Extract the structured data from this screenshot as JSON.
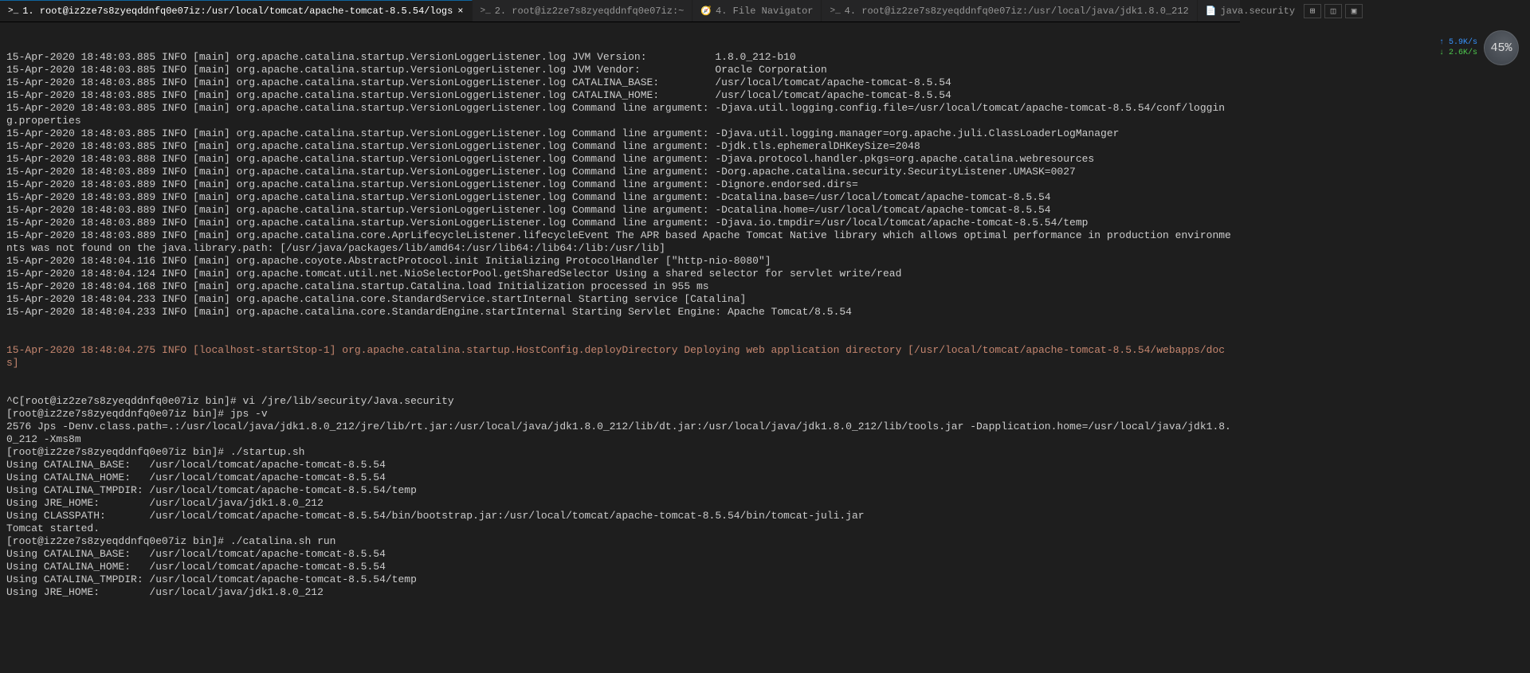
{
  "tabs": [
    {
      "icon": ">_",
      "label": "1. root@iz2ze7s8zyeqddnfq0e07iz:/usr/local/tomcat/apache-tomcat-8.5.54/logs",
      "active": true,
      "closeable": true
    },
    {
      "icon": ">_",
      "label": "2. root@iz2ze7s8zyeqddnfq0e07iz:~",
      "active": false
    },
    {
      "icon": "🧭",
      "label": "4. File Navigator",
      "active": false
    },
    {
      "icon": ">_",
      "label": "4. root@iz2ze7s8zyeqddnfq0e07iz:/usr/local/java/jdk1.8.0_212",
      "active": false
    },
    {
      "icon": "📄",
      "label": "java.security",
      "active": false
    }
  ],
  "lines": [
    "15-Apr-2020 18:48:03.885 INFO [main] org.apache.catalina.startup.VersionLoggerListener.log JVM Version:           1.8.0_212-b10",
    "15-Apr-2020 18:48:03.885 INFO [main] org.apache.catalina.startup.VersionLoggerListener.log JVM Vendor:            Oracle Corporation",
    "15-Apr-2020 18:48:03.885 INFO [main] org.apache.catalina.startup.VersionLoggerListener.log CATALINA_BASE:         /usr/local/tomcat/apache-tomcat-8.5.54",
    "15-Apr-2020 18:48:03.885 INFO [main] org.apache.catalina.startup.VersionLoggerListener.log CATALINA_HOME:         /usr/local/tomcat/apache-tomcat-8.5.54",
    "15-Apr-2020 18:48:03.885 INFO [main] org.apache.catalina.startup.VersionLoggerListener.log Command line argument: -Djava.util.logging.config.file=/usr/local/tomcat/apache-tomcat-8.5.54/conf/logging.properties",
    "15-Apr-2020 18:48:03.885 INFO [main] org.apache.catalina.startup.VersionLoggerListener.log Command line argument: -Djava.util.logging.manager=org.apache.juli.ClassLoaderLogManager",
    "15-Apr-2020 18:48:03.885 INFO [main] org.apache.catalina.startup.VersionLoggerListener.log Command line argument: -Djdk.tls.ephemeralDHKeySize=2048",
    "15-Apr-2020 18:48:03.888 INFO [main] org.apache.catalina.startup.VersionLoggerListener.log Command line argument: -Djava.protocol.handler.pkgs=org.apache.catalina.webresources",
    "15-Apr-2020 18:48:03.889 INFO [main] org.apache.catalina.startup.VersionLoggerListener.log Command line argument: -Dorg.apache.catalina.security.SecurityListener.UMASK=0027",
    "15-Apr-2020 18:48:03.889 INFO [main] org.apache.catalina.startup.VersionLoggerListener.log Command line argument: -Dignore.endorsed.dirs=",
    "15-Apr-2020 18:48:03.889 INFO [main] org.apache.catalina.startup.VersionLoggerListener.log Command line argument: -Dcatalina.base=/usr/local/tomcat/apache-tomcat-8.5.54",
    "15-Apr-2020 18:48:03.889 INFO [main] org.apache.catalina.startup.VersionLoggerListener.log Command line argument: -Dcatalina.home=/usr/local/tomcat/apache-tomcat-8.5.54",
    "15-Apr-2020 18:48:03.889 INFO [main] org.apache.catalina.startup.VersionLoggerListener.log Command line argument: -Djava.io.tmpdir=/usr/local/tomcat/apache-tomcat-8.5.54/temp",
    "15-Apr-2020 18:48:03.889 INFO [main] org.apache.catalina.core.AprLifecycleListener.lifecycleEvent The APR based Apache Tomcat Native library which allows optimal performance in production environments was not found on the java.library.path: [/usr/java/packages/lib/amd64:/usr/lib64:/lib64:/lib:/usr/lib]",
    "15-Apr-2020 18:48:04.116 INFO [main] org.apache.coyote.AbstractProtocol.init Initializing ProtocolHandler [\"http-nio-8080\"]",
    "15-Apr-2020 18:48:04.124 INFO [main] org.apache.tomcat.util.net.NioSelectorPool.getSharedSelector Using a shared selector for servlet write/read",
    "15-Apr-2020 18:48:04.168 INFO [main] org.apache.catalina.startup.Catalina.load Initialization processed in 955 ms",
    "15-Apr-2020 18:48:04.233 INFO [main] org.apache.catalina.core.StandardService.startInternal Starting service [Catalina]",
    "15-Apr-2020 18:48:04.233 INFO [main] org.apache.catalina.core.StandardEngine.startInternal Starting Servlet Engine: Apache Tomcat/8.5.54"
  ],
  "highlighted_line": "15-Apr-2020 18:48:04.275 INFO [localhost-startStop-1] org.apache.catalina.startup.HostConfig.deployDirectory Deploying web application directory [/usr/local/tomcat/apache-tomcat-8.5.54/webapps/docs]",
  "shell_lines": [
    "^C[root@iz2ze7s8zyeqddnfq0e07iz bin]# vi /jre/lib/security/Java.security",
    "[root@iz2ze7s8zyeqddnfq0e07iz bin]# jps -v",
    "2576 Jps -Denv.class.path=.:/usr/local/java/jdk1.8.0_212/jre/lib/rt.jar:/usr/local/java/jdk1.8.0_212/lib/dt.jar:/usr/local/java/jdk1.8.0_212/lib/tools.jar -Dapplication.home=/usr/local/java/jdk1.8.0_212 -Xms8m",
    "[root@iz2ze7s8zyeqddnfq0e07iz bin]# ./startup.sh",
    "Using CATALINA_BASE:   /usr/local/tomcat/apache-tomcat-8.5.54",
    "Using CATALINA_HOME:   /usr/local/tomcat/apache-tomcat-8.5.54",
    "Using CATALINA_TMPDIR: /usr/local/tomcat/apache-tomcat-8.5.54/temp",
    "Using JRE_HOME:        /usr/local/java/jdk1.8.0_212",
    "Using CLASSPATH:       /usr/local/tomcat/apache-tomcat-8.5.54/bin/bootstrap.jar:/usr/local/tomcat/apache-tomcat-8.5.54/bin/tomcat-juli.jar",
    "Tomcat started.",
    "[root@iz2ze7s8zyeqddnfq0e07iz bin]# ./catalina.sh run",
    "Using CATALINA_BASE:   /usr/local/tomcat/apache-tomcat-8.5.54",
    "Using CATALINA_HOME:   /usr/local/tomcat/apache-tomcat-8.5.54",
    "Using CATALINA_TMPDIR: /usr/local/tomcat/apache-tomcat-8.5.54/temp",
    "Using JRE_HOME:        /usr/local/java/jdk1.8.0_212"
  ],
  "net": {
    "up": "↑ 5.9K/s",
    "down": "↓ 2.6K/s",
    "pct": "45%"
  }
}
